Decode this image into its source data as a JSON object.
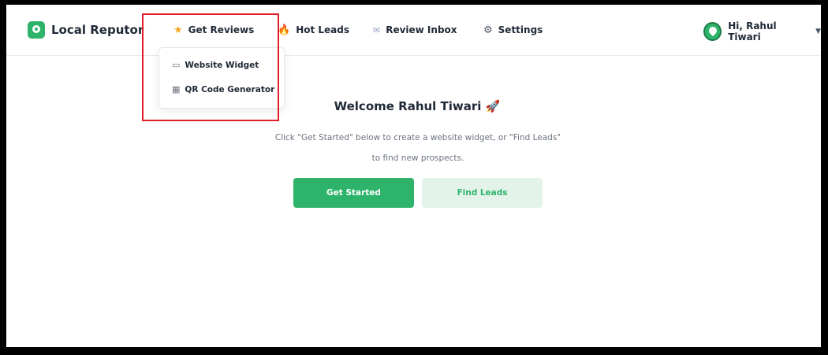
{
  "brand": {
    "name": "Local Reputor",
    "logo_icon": "location-pin-icon",
    "color": "#2eb46a"
  },
  "nav": {
    "items": [
      {
        "label": "Get Reviews",
        "icon": "star-icon"
      },
      {
        "label": "Hot Leads",
        "icon": "fire-icon"
      },
      {
        "label": "Review Inbox",
        "icon": "inbox-icon"
      },
      {
        "label": "Settings",
        "icon": "gear-icon"
      }
    ]
  },
  "dropdown": {
    "items": [
      {
        "label": "Website Widget",
        "icon": "window-icon"
      },
      {
        "label": "QR Code Generator",
        "icon": "qr-code-icon"
      }
    ]
  },
  "user": {
    "greeting": "Hi, Rahul Tiwari"
  },
  "main": {
    "welcome": "Welcome Rahul Tiwari",
    "subtitle_line1": "Click \"Get Started\" below to create a website widget, or \"Find Leads\"",
    "subtitle_line2": "to find new prospects.",
    "primary_button": "Get Started",
    "secondary_button": "Find Leads"
  },
  "colors": {
    "accent": "#2eb46a",
    "accent_light": "#e4f3ea",
    "highlight": "#e11d2a"
  }
}
